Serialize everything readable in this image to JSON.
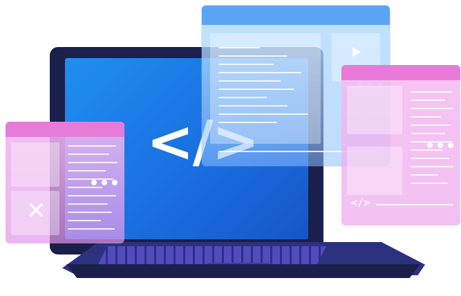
{
  "screen_symbol": "</>",
  "right_window_symbol": "</>",
  "icons": {
    "tools": "tools-icon",
    "play": "play-icon",
    "window_dots": "window-controls-dots"
  },
  "colors": {
    "laptop_body": "#1b1f4b",
    "screen_blue": "#1a6fe0",
    "window_blue": "#5aa5f5",
    "window_pink": "#e97ad9"
  }
}
